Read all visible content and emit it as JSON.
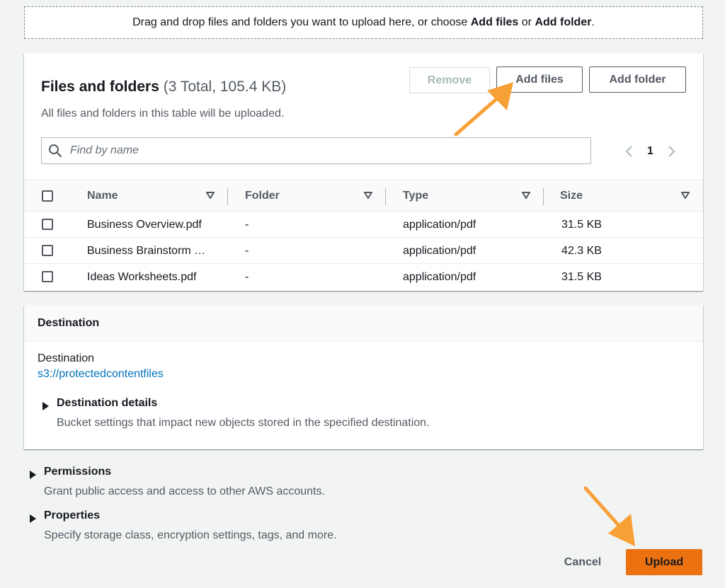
{
  "dropzone": {
    "text_before": "Drag and drop files and folders you want to upload here, or choose ",
    "add_files": "Add files",
    "or": " or ",
    "add_folder": "Add folder",
    "period": "."
  },
  "files_panel": {
    "title": "Files and folders",
    "count": "(3 Total, 105.4 KB)",
    "description": "All files and folders in this table will be uploaded.",
    "remove_label": "Remove",
    "add_files_label": "Add files",
    "add_folder_label": "Add folder",
    "search_placeholder": "Find by name",
    "page": "1",
    "columns": {
      "name": "Name",
      "folder": "Folder",
      "type": "Type",
      "size": "Size"
    },
    "rows": [
      {
        "name": "Business Overview.pdf",
        "folder": "-",
        "type": "application/pdf",
        "size": "31.5 KB"
      },
      {
        "name": "Business Brainstorm …",
        "folder": "-",
        "type": "application/pdf",
        "size": "42.3 KB"
      },
      {
        "name": "Ideas Worksheets.pdf",
        "folder": "-",
        "type": "application/pdf",
        "size": "31.5 KB"
      }
    ]
  },
  "destination": {
    "header": "Destination",
    "label": "Destination",
    "link": "s3://protectedcontentfiles",
    "details_title": "Destination details",
    "details_desc": "Bucket settings that impact new objects stored in the specified destination."
  },
  "permissions": {
    "title": "Permissions",
    "desc": "Grant public access and access to other AWS accounts."
  },
  "properties": {
    "title": "Properties",
    "desc": "Specify storage class, encryption settings, tags, and more."
  },
  "actions": {
    "cancel": "Cancel",
    "upload": "Upload"
  },
  "colors": {
    "accent": "#ec7211",
    "link": "#0073bb",
    "annotation": "#f7a035"
  }
}
